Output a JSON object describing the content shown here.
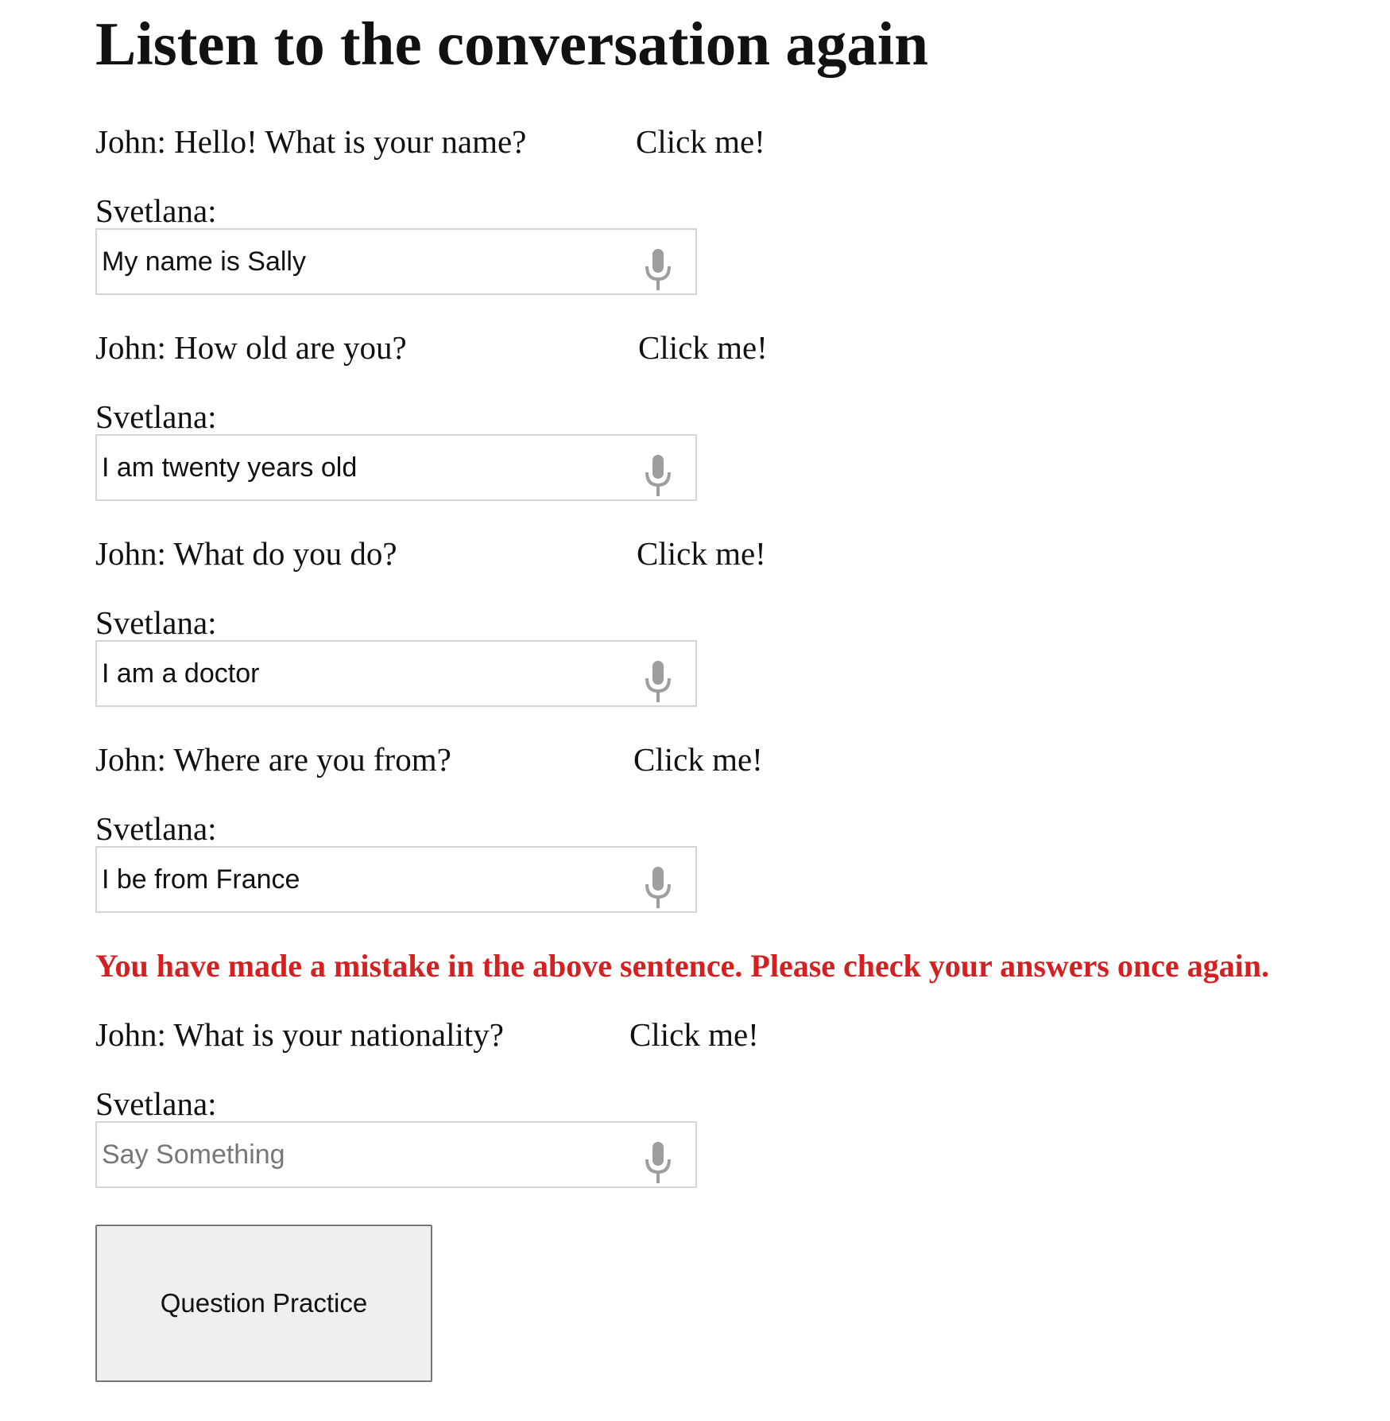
{
  "page": {
    "title": "Listen to the conversation again"
  },
  "dialog": [
    {
      "question": "John: Hello! What is your name?",
      "click_label": "Click me!",
      "speaker": "Svetlana:",
      "answer_value": "My name is Sally",
      "placeholder": "Say Something"
    },
    {
      "question": "John: How old are you?",
      "click_label": "Click me!",
      "speaker": "Svetlana:",
      "answer_value": "I am twenty years old",
      "placeholder": "Say Something"
    },
    {
      "question": "John: What do you do?",
      "click_label": "Click me!",
      "speaker": "Svetlana:",
      "answer_value": "I am a doctor",
      "placeholder": "Say Something"
    },
    {
      "question": "John: Where are you from?",
      "click_label": "Click me!",
      "speaker": "Svetlana:",
      "answer_value": "I be from France",
      "placeholder": "Say Something"
    },
    {
      "question": "John: What is your nationality?",
      "click_label": "Click me!",
      "speaker": "Svetlana:",
      "answer_value": "",
      "placeholder": "Say Something"
    }
  ],
  "error": {
    "message": "You have made a mistake in the above sentence. Please check your answers once again.",
    "color": "#d42020"
  },
  "button": {
    "label": "Question Practice"
  },
  "icons": {
    "mic": "microphone-icon"
  },
  "colors": {
    "mic_gray": "#9e9e9e",
    "input_border": "#d4d4d4",
    "button_bg": "#efefef"
  }
}
